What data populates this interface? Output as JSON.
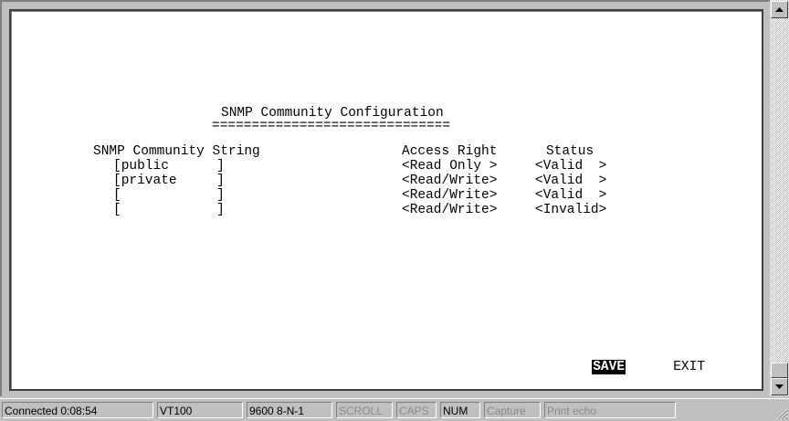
{
  "screen": {
    "title": "SNMP Community Configuration",
    "underline": "==============================",
    "headers": {
      "community": "SNMP Community String",
      "access": "Access Right",
      "status": "Status"
    },
    "rows": [
      {
        "community": "[public      ]",
        "access": "<Read Only >",
        "status": "<Valid  >"
      },
      {
        "community": "[private     ]",
        "access": "<Read/Write>",
        "status": "<Valid  >"
      },
      {
        "community": "[            ]",
        "access": "<Read/Write>",
        "status": "<Valid  >"
      },
      {
        "community": "[            ]",
        "access": "<Read/Write>",
        "status": "<Invalid>"
      }
    ],
    "save_label": "SAVE",
    "exit_label": "EXIT"
  },
  "statusbar": {
    "connected": "Connected 0:08:54",
    "emulation": "VT100",
    "port": "9600 8-N-1",
    "scroll": "SCROLL",
    "caps": "CAPS",
    "num": "NUM",
    "capture": "Capture",
    "print_echo": "Print echo"
  },
  "icons": {
    "scroll_up": "scroll-up-arrow-icon",
    "scroll_down": "scroll-down-arrow-icon",
    "resize_grip": "resize-grip-icon"
  }
}
